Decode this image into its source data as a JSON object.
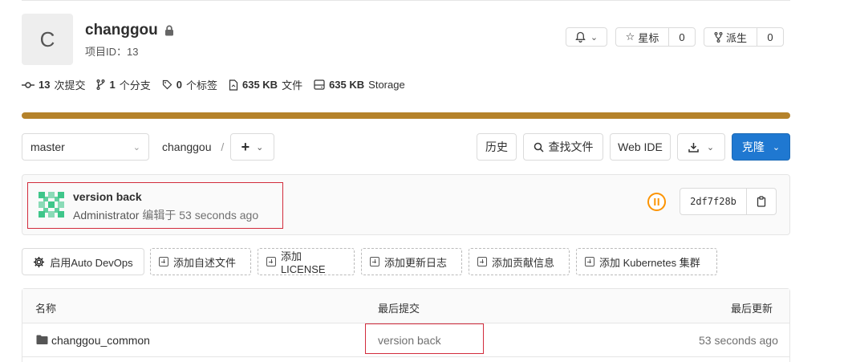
{
  "project": {
    "avatar_letter": "C",
    "name": "changgou",
    "id_label": "项目ID：13"
  },
  "header_buttons": {
    "star_label": "星标",
    "star_count": "0",
    "fork_label": "派生",
    "fork_count": "0"
  },
  "stats": {
    "commits_count": "13",
    "commits_label": "次提交",
    "branches_count": "1",
    "branches_label": "个分支",
    "tags_count": "0",
    "tags_label": "个标签",
    "files_size": "635 KB",
    "files_label": "文件",
    "storage_size": "635 KB",
    "storage_label": "Storage"
  },
  "toolbar": {
    "branch": "master",
    "breadcrumb": "changgou",
    "separator": "/",
    "history": "历史",
    "find_file": "查找文件",
    "web_ide": "Web IDE",
    "clone": "克隆"
  },
  "last_commit": {
    "title": "version back",
    "author": "Administrator",
    "edited": "编辑于",
    "time": "53 seconds ago",
    "sha": "2df7f28b"
  },
  "actions": {
    "auto_devops": "启用Auto DevOps",
    "add_readme": "添加自述文件",
    "add_license": "添加LICENSE",
    "add_changelog": "添加更新日志",
    "add_contributing": "添加贡献信息",
    "add_k8s": "添加 Kubernetes 集群"
  },
  "table": {
    "headers": [
      "名称",
      "最后提交",
      "最后更新"
    ],
    "rows": [
      {
        "name": "changgou_common",
        "commit": "version back",
        "updated": "53 seconds ago"
      }
    ]
  },
  "colors": {
    "accent": "#1f78d1",
    "progress": "#b5822a",
    "highlight": "#d22c3c",
    "pipeline": "#fc9403"
  }
}
